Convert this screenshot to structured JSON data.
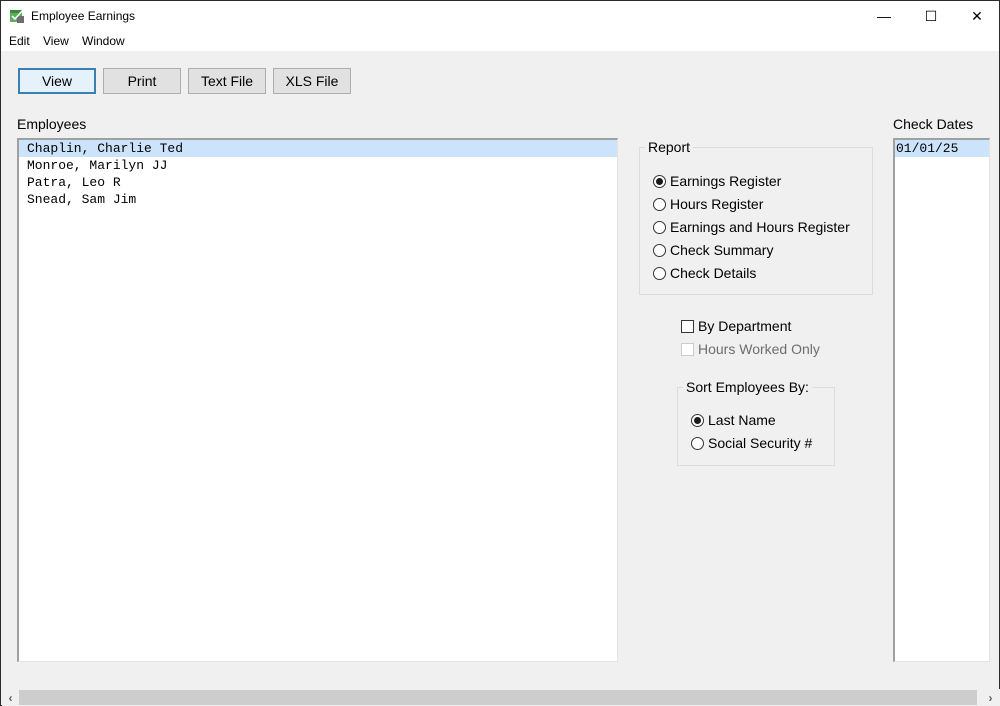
{
  "window": {
    "title": "Employee Earnings",
    "controls": {
      "minimize": "—",
      "maximize": "☐",
      "close": "✕"
    }
  },
  "menu": [
    "Edit",
    "View",
    "Window"
  ],
  "toolbar": {
    "view_label": "View",
    "print_label": "Print",
    "text_file_label": "Text File",
    "xls_file_label": "XLS File"
  },
  "employees": {
    "label": "Employees",
    "items": [
      {
        "name": "Chaplin, Charlie Ted",
        "selected": true
      },
      {
        "name": "Monroe, Marilyn JJ",
        "selected": false
      },
      {
        "name": "Patra, Leo R",
        "selected": false
      },
      {
        "name": "Snead, Sam Jim",
        "selected": false
      }
    ]
  },
  "report": {
    "title": "Report",
    "options": [
      {
        "label": "Earnings Register",
        "selected": true
      },
      {
        "label": "Hours Register",
        "selected": false
      },
      {
        "label": "Earnings and Hours Register",
        "selected": false
      },
      {
        "label": "Check Summary",
        "selected": false
      },
      {
        "label": "Check Details",
        "selected": false
      }
    ]
  },
  "options": {
    "by_department": {
      "label": "By Department",
      "checked": false,
      "enabled": true
    },
    "hours_worked_only": {
      "label": "Hours Worked Only",
      "checked": false,
      "enabled": false
    }
  },
  "sort": {
    "title": "Sort Employees By:",
    "options": [
      {
        "label": "Last Name",
        "selected": true
      },
      {
        "label": "Social Security #",
        "selected": false
      }
    ]
  },
  "check_dates": {
    "label": "Check Dates",
    "items": [
      {
        "date": "01/01/25",
        "selected": true
      }
    ]
  },
  "scrollbar": {
    "left_arrow": "‹",
    "right_arrow": "›"
  }
}
